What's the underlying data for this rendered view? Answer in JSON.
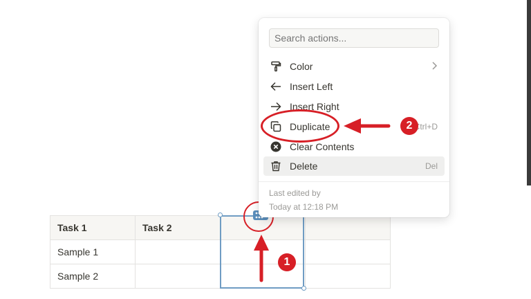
{
  "menu": {
    "search_placeholder": "Search actions...",
    "items": [
      {
        "label": "Color",
        "icon": "paint-roller-icon",
        "shortcut": ""
      },
      {
        "label": "Insert Left",
        "icon": "arrow-left-icon",
        "shortcut": ""
      },
      {
        "label": "Insert Right",
        "icon": "arrow-right-icon",
        "shortcut": ""
      },
      {
        "label": "Duplicate",
        "icon": "duplicate-icon",
        "shortcut": "Ctrl+D"
      },
      {
        "label": "Clear Contents",
        "icon": "clear-circle-icon",
        "shortcut": ""
      },
      {
        "label": "Delete",
        "icon": "trash-icon",
        "shortcut": "Del"
      }
    ],
    "last_edited_label": "Last edited by",
    "last_edited_time": "Today at 12:18 PM"
  },
  "table": {
    "header": [
      "Task 1",
      "Task 2",
      "",
      ""
    ],
    "rows": [
      [
        "Sample 1",
        "",
        "",
        ""
      ],
      [
        "Sample 2",
        "",
        "",
        ""
      ]
    ]
  },
  "annotations": {
    "step1": "1",
    "step2": "2"
  },
  "colors": {
    "annotation_red": "#d71f26",
    "selection_blue": "#6f9cc3"
  }
}
